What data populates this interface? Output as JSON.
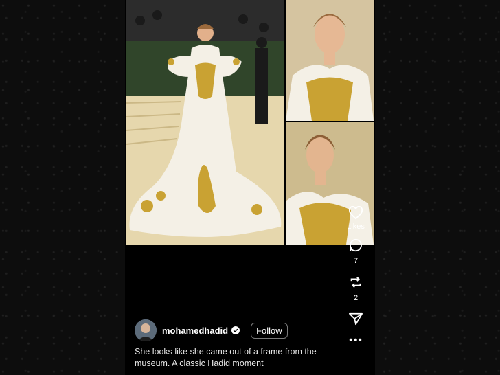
{
  "post": {
    "likes_label": "Likes",
    "comments_count": "7",
    "reposts_count": "2",
    "more_label": "•••",
    "author": {
      "username": "mohamedhadid",
      "follow_label": "Follow"
    },
    "caption": "She looks like she came out of a frame from the museum.  A classic Hadid moment"
  },
  "colors": {
    "background": "#0b0b0b",
    "post_background": "#000000",
    "verified_badge": "#ffffff",
    "gown": "#f4f0e6",
    "gold": "#c9a233"
  },
  "icons": [
    "heart-icon",
    "comment-icon",
    "repost-icon",
    "share-icon",
    "more-icon",
    "verified-icon"
  ]
}
